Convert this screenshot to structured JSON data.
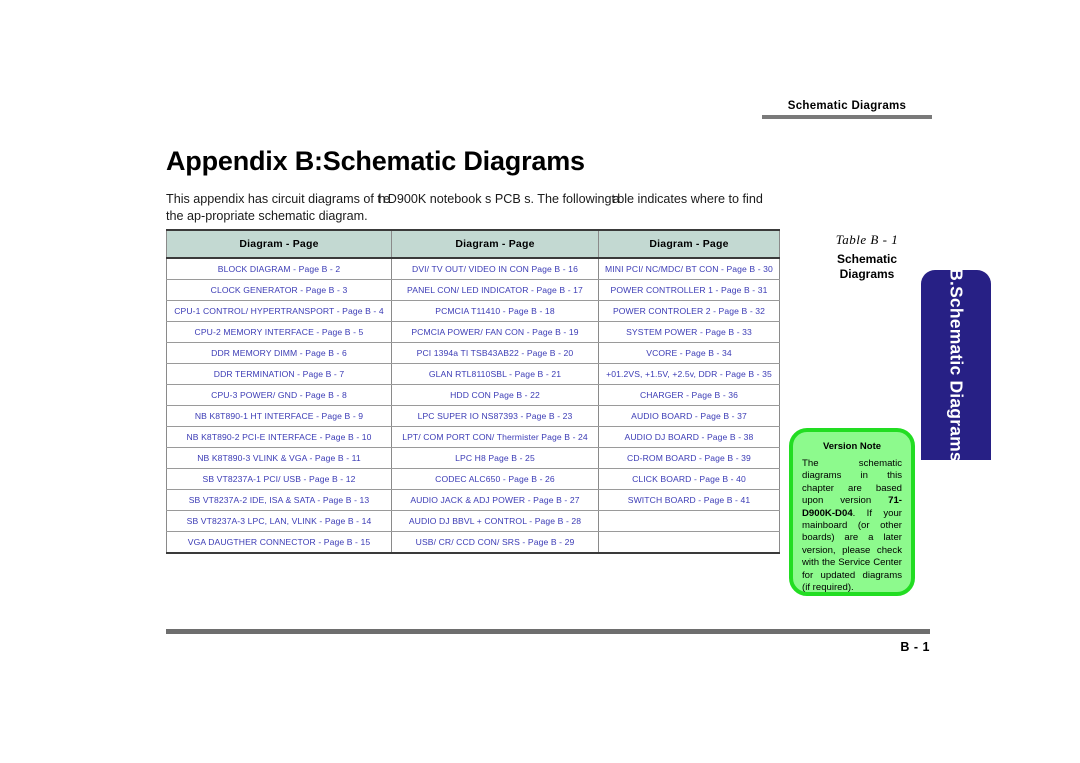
{
  "header": {
    "running_head": "Schematic  Diagrams"
  },
  "title": "Appendix B:Schematic Diagrams",
  "intro": {
    "part1": "This appendix has circuit diagrams of ",
    "overlap1": "the",
    "part2": "D900K",
    "part3": " notebook s PCB s. The following",
    "overlap2": "ta",
    "part4": "ble indicates where to find the ap-propriate schematic diagram.",
    "full_text": "This appendix has circuit diagrams of the D900K notebook s PCB s. The following table indicates where to find the appropriate schematic diagram."
  },
  "table": {
    "headers": [
      "Diagram - Page",
      "Diagram - Page",
      "Diagram - Page"
    ],
    "rows": [
      [
        "BLOCK DIAGRAM - Page  B - 2",
        "DVI/ TV OUT/ VIDEO IN CON Page  B - 16",
        "MINI PCI/ NC/MDC/ BT CON - Page  B - 30"
      ],
      [
        "CLOCK GENERATOR - Page  B - 3",
        "PANEL CON/ LED INDICATOR - Page  B - 17",
        "POWER CONTROLLER 1 - Page  B - 31"
      ],
      [
        "CPU-1 CONTROL/ HYPERTRANSPORT - Page  B - 4",
        "PCMCIA T11410 - Page  B - 18",
        "POWER CONTROLER 2 - Page  B - 32"
      ],
      [
        "CPU-2 MEMORY INTERFACE - Page  B - 5",
        "PCMCIA POWER/ FAN CON - Page  B - 19",
        "SYSTEM POWER - Page  B - 33"
      ],
      [
        "DDR MEMORY DIMM - Page  B - 6",
        "PCI 1394a TI TSB43AB22 - Page  B - 20",
        "VCORE - Page  B - 34"
      ],
      [
        "DDR TERMINATION - Page  B - 7",
        "GLAN RTL8110SBL - Page  B - 21",
        "+01.2VS, +1.5V, +2.5v, DDR - Page  B - 35"
      ],
      [
        "CPU-3 POWER/ GND - Page  B - 8",
        "HDD CON Page  B - 22",
        "CHARGER - Page  B - 36"
      ],
      [
        "NB K8T890-1 HT INTERFACE - Page  B - 9",
        "LPC SUPER IO NS87393 - Page  B - 23",
        "AUDIO BOARD - Page  B - 37"
      ],
      [
        "NB K8T890-2 PCI-E INTERFACE - Page  B - 10",
        "LPT/ COM PORT CON/ Thermister Page  B - 24",
        "AUDIO DJ BOARD - Page  B - 38"
      ],
      [
        "NB K8T890-3 VLINK & VGA - Page  B - 11",
        "LPC H8 Page  B - 25",
        "CD-ROM BOARD - Page  B - 39"
      ],
      [
        "SB VT8237A-1 PCI/ USB - Page  B - 12",
        "CODEC ALC650 - Page  B - 26",
        "CLICK BOARD - Page  B - 40"
      ],
      [
        "SB VT8237A-2 IDE, ISA & SATA - Page  B - 13",
        "AUDIO JACK & ADJ POWER - Page  B - 27",
        "SWITCH BOARD - Page  B - 41"
      ],
      [
        "SB VT8237A-3 LPC, LAN, VLINK - Page  B - 14",
        "AUDIO DJ BBVL + CONTROL - Page  B - 28",
        ""
      ],
      [
        "VGA DAUGTHER CONNECTOR - Page  B - 15",
        "USB/ CR/ CCD CON/ SRS - Page  B - 29",
        ""
      ]
    ]
  },
  "caption": {
    "number": "Table B - 1",
    "title_line1": "Schematic",
    "title_line2": "Diagrams"
  },
  "side_tab": {
    "label": "B.Schematic Diagrams",
    "color": "#272085"
  },
  "version_note": {
    "title": "Version Note",
    "body_before": "The schematic diagrams in this chapter are based upon version ",
    "version": "71-D900K-D04",
    "body_after": ". If your mainboard (or other boards) are a later version, please check with the Service Center for updated diagrams (if required).",
    "box_color": "#8dfa8d",
    "border_color": "#22dd22"
  },
  "footer": {
    "page_number": "B - 1"
  }
}
